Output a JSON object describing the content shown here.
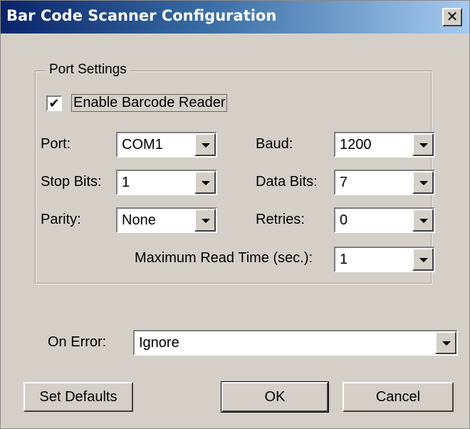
{
  "window": {
    "title": "Bar Code Scanner Configuration",
    "close_glyph": "✕"
  },
  "port_settings": {
    "legend": "Port Settings",
    "enable_checkbox": {
      "label": "Enable Barcode Reader",
      "checked": true,
      "check_glyph": "✔"
    },
    "port": {
      "label": "Port:",
      "value": "COM1"
    },
    "baud": {
      "label": "Baud:",
      "value": "1200"
    },
    "stop_bits": {
      "label": "Stop Bits:",
      "value": "1"
    },
    "data_bits": {
      "label": "Data Bits:",
      "value": "7"
    },
    "parity": {
      "label": "Parity:",
      "value": "None"
    },
    "retries": {
      "label": "Retries:",
      "value": "0"
    },
    "max_read_time": {
      "label": "Maximum Read Time (sec.):",
      "value": "1"
    }
  },
  "on_error": {
    "label": "On Error:",
    "value": "Ignore"
  },
  "buttons": {
    "set_defaults": "Set Defaults",
    "ok": "OK",
    "cancel": "Cancel"
  },
  "colors": {
    "dialog_bg": "#d4d0c8",
    "title_start": "#0a246a",
    "title_end": "#a6caf0"
  }
}
